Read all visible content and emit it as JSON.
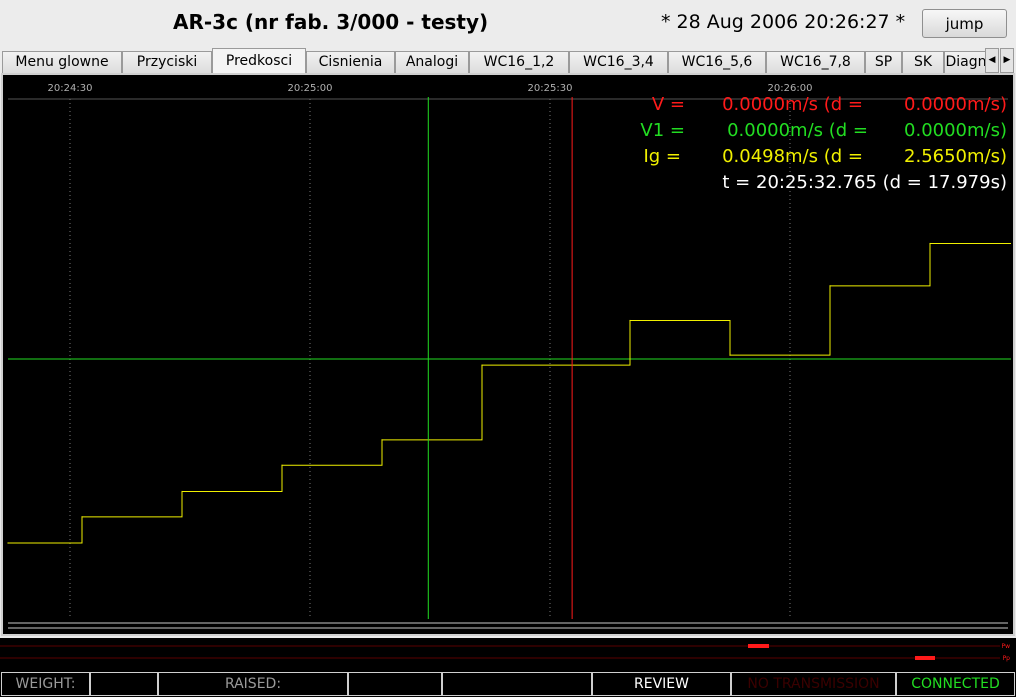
{
  "header": {
    "title": "AR-3c (nr fab. 3/000 - testy)",
    "datetime": "* 28 Aug 2006  20:26:27 *",
    "jump_label": "jump"
  },
  "tabs": [
    {
      "label": "Menu glowne",
      "active": false
    },
    {
      "label": "Przyciski",
      "active": false
    },
    {
      "label": "Predkosci",
      "active": true
    },
    {
      "label": "Cisnienia",
      "active": false
    },
    {
      "label": "Analogi",
      "active": false
    },
    {
      "label": "WC16_1,2",
      "active": false
    },
    {
      "label": "WC16_3,4",
      "active": false
    },
    {
      "label": "WC16_5,6",
      "active": false
    },
    {
      "label": "WC16_7,8",
      "active": false
    },
    {
      "label": "SP",
      "active": false
    },
    {
      "label": "SK",
      "active": false
    },
    {
      "label": "Diagn",
      "active": false
    }
  ],
  "tab_scroll": {
    "left_icon": "◀",
    "right_icon": "▶"
  },
  "readout": {
    "v": {
      "name": "V =",
      "value": "0.0000m/s (d =",
      "delta": "0.0000m/s)",
      "color": "#ff1a1a"
    },
    "v1": {
      "name": "V1 =",
      "value": "0.0000m/s (d =",
      "delta": "0.0000m/s)",
      "color": "#22dd22"
    },
    "ig": {
      "name": "Ig =",
      "value": "0.0498m/s (d =",
      "delta": "2.5650m/s)",
      "color": "#f0f000"
    },
    "t": {
      "text": "t = 20:25:32.765 (d = 17.979s)",
      "color": "#ffffff"
    }
  },
  "chart_data": {
    "type": "line",
    "x_ticks": [
      "20:24:30",
      "20:25:00",
      "20:25:30",
      "20:26:00"
    ],
    "series": [
      {
        "name": "Ig",
        "color": "#f0f000",
        "x": [
          "20:24:19",
          "20:24:31.5",
          "20:24:44",
          "20:24:56.5",
          "20:25:09",
          "20:25:21.5",
          "20:25:40",
          "20:25:52.5",
          "20:26:05",
          "20:26:17.5"
        ],
        "values": [
          -2.39,
          -2.05,
          -1.72,
          -1.38,
          -1.05,
          -0.08,
          0.5,
          0.05,
          0.95,
          1.5
        ]
      },
      {
        "name": "V1",
        "color": "#22dd22",
        "values": [
          0.0
        ]
      },
      {
        "name": "V",
        "color": "#ff1a1a",
        "values": [
          0.0
        ]
      }
    ],
    "cursors": [
      {
        "name": "reference",
        "time": "20:25:14.786",
        "color": "#22dd22"
      },
      {
        "name": "cursor",
        "time": "20:25:32.765",
        "color": "#ff1a1a"
      }
    ]
  },
  "status": {
    "weight_label": "WEIGHT:",
    "raised_label": "RAISED:",
    "review_label": "REVIEW",
    "no_transmission_label": "NO TRANSMISSION",
    "connected_label": "CONNECTED",
    "connected_color": "#22dd22",
    "no_transmission_color": "#3a0000"
  },
  "strip": {
    "labels": [
      "Pw",
      "Pp"
    ],
    "color": "#ff1a1a"
  }
}
